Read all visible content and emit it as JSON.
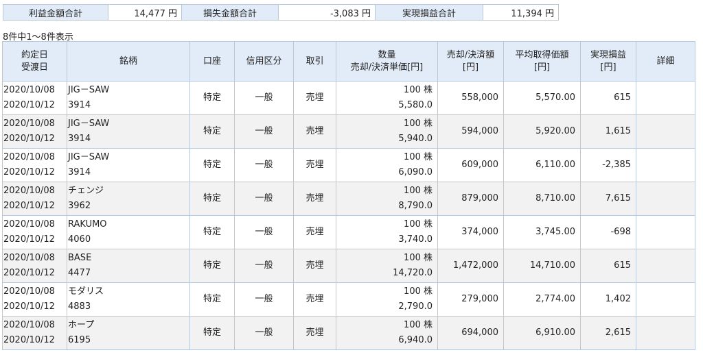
{
  "summary": {
    "profit_label": "利益金額合計",
    "profit_value": "14,477 円",
    "loss_label": "損失金額合計",
    "loss_value": "-3,083 円",
    "realized_label": "実現損益合計",
    "realized_value": "11,394 円"
  },
  "count_text": "8件中1～8件表示",
  "headers": {
    "date_1": "約定日",
    "date_2": "受渡日",
    "name": "銘柄",
    "account": "口座",
    "credit": "信用区分",
    "trade": "取引",
    "qty_1": "数量",
    "qty_2": "売却/決済単価[円]",
    "proceeds_1": "売却/決済額",
    "proceeds_2": "[円]",
    "avg_1": "平均取得価額",
    "avg_2": "[円]",
    "pl_1": "実現損益",
    "pl_2": "[円]",
    "detail": "詳細"
  },
  "rows": [
    {
      "trade_date": "2020/10/08",
      "settle_date": "2020/10/12",
      "name": "JIG－SAW",
      "code": "3914",
      "account": "特定",
      "credit": "一般",
      "trade": "売埋",
      "qty": "100 株",
      "price": "5,580.0",
      "proceeds": "558,000",
      "avg_cost": "5,570.00",
      "pl": "615"
    },
    {
      "trade_date": "2020/10/08",
      "settle_date": "2020/10/12",
      "name": "JIG－SAW",
      "code": "3914",
      "account": "特定",
      "credit": "一般",
      "trade": "売埋",
      "qty": "100 株",
      "price": "5,940.0",
      "proceeds": "594,000",
      "avg_cost": "5,920.00",
      "pl": "1,615"
    },
    {
      "trade_date": "2020/10/08",
      "settle_date": "2020/10/12",
      "name": "JIG－SAW",
      "code": "3914",
      "account": "特定",
      "credit": "一般",
      "trade": "売埋",
      "qty": "100 株",
      "price": "6,090.0",
      "proceeds": "609,000",
      "avg_cost": "6,110.00",
      "pl": "-2,385"
    },
    {
      "trade_date": "2020/10/08",
      "settle_date": "2020/10/12",
      "name": "チェンジ",
      "code": "3962",
      "account": "特定",
      "credit": "一般",
      "trade": "売埋",
      "qty": "100 株",
      "price": "8,790.0",
      "proceeds": "879,000",
      "avg_cost": "8,710.00",
      "pl": "7,615"
    },
    {
      "trade_date": "2020/10/08",
      "settle_date": "2020/10/12",
      "name": "RAKUMO",
      "code": "4060",
      "account": "特定",
      "credit": "一般",
      "trade": "売埋",
      "qty": "100 株",
      "price": "3,740.0",
      "proceeds": "374,000",
      "avg_cost": "3,745.00",
      "pl": "-698"
    },
    {
      "trade_date": "2020/10/08",
      "settle_date": "2020/10/12",
      "name": "BASE",
      "code": "4477",
      "account": "特定",
      "credit": "一般",
      "trade": "売埋",
      "qty": "100 株",
      "price": "14,720.0",
      "proceeds": "1,472,000",
      "avg_cost": "14,710.00",
      "pl": "615"
    },
    {
      "trade_date": "2020/10/08",
      "settle_date": "2020/10/12",
      "name": "モダリス",
      "code": "4883",
      "account": "特定",
      "credit": "一般",
      "trade": "売埋",
      "qty": "100 株",
      "price": "2,790.0",
      "proceeds": "279,000",
      "avg_cost": "2,774.00",
      "pl": "1,402"
    },
    {
      "trade_date": "2020/10/08",
      "settle_date": "2020/10/12",
      "name": "ホープ",
      "code": "6195",
      "account": "特定",
      "credit": "一般",
      "trade": "売埋",
      "qty": "100 株",
      "price": "6,940.0",
      "proceeds": "694,000",
      "avg_cost": "6,910.00",
      "pl": "2,615"
    }
  ]
}
